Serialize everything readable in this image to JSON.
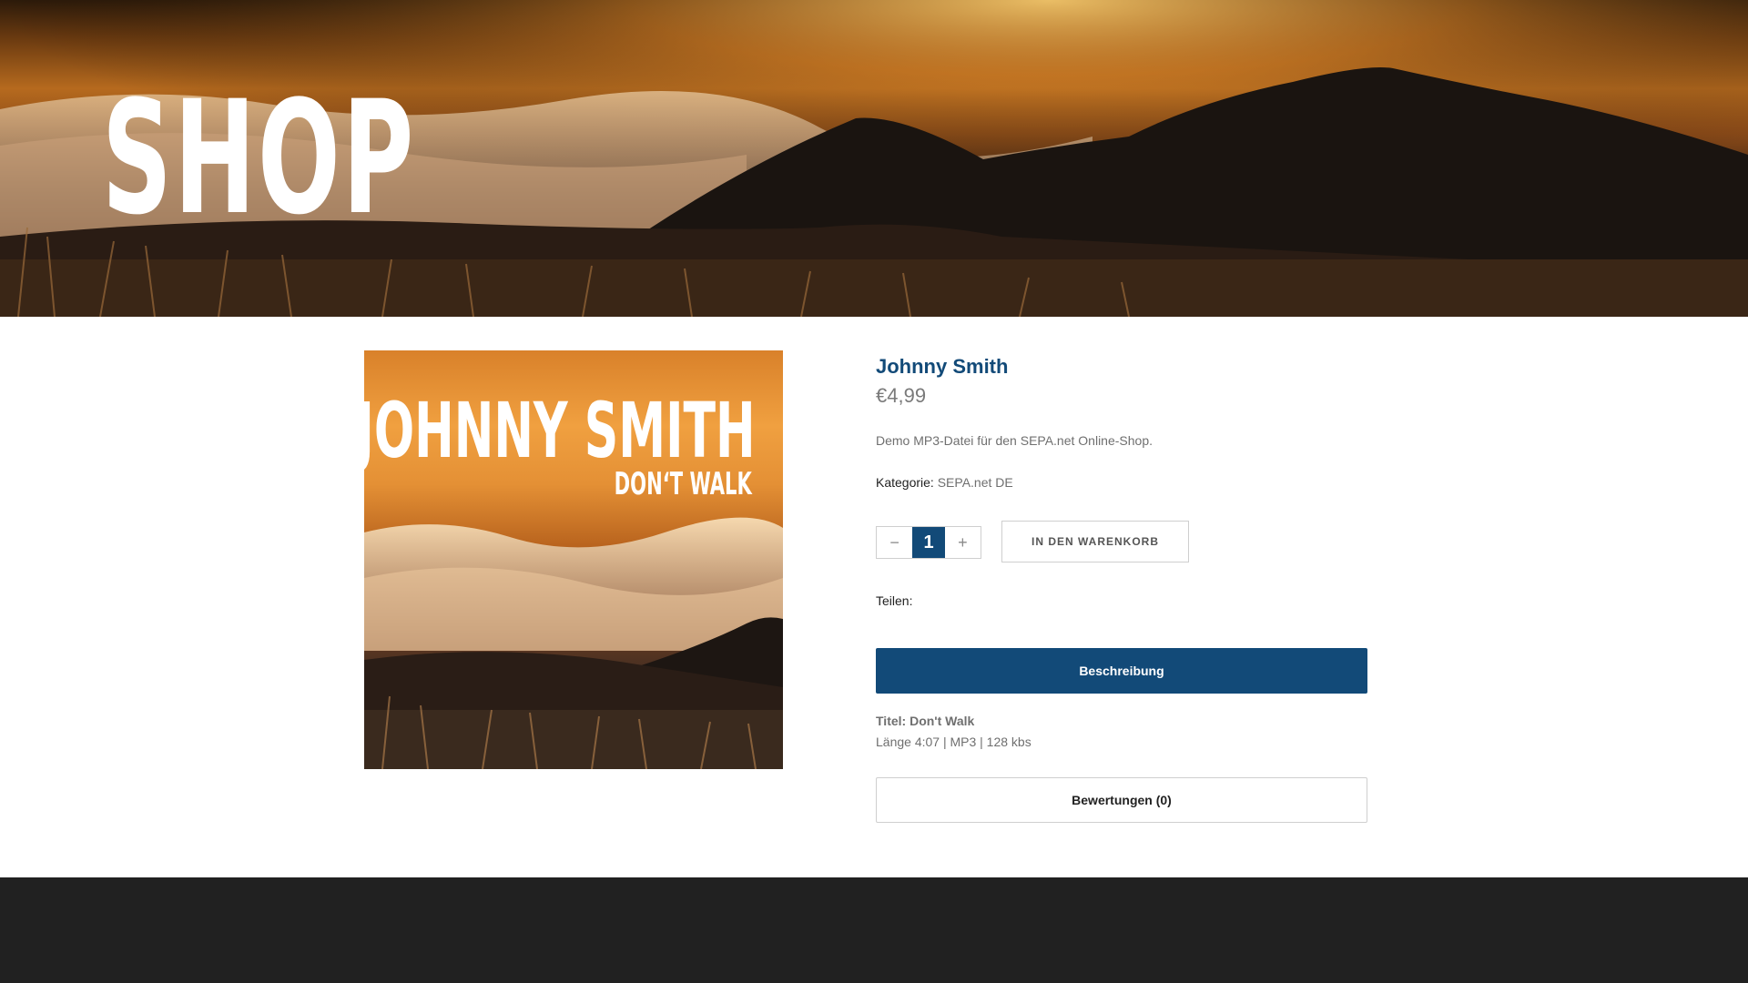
{
  "hero": {
    "title": "SHOP"
  },
  "product": {
    "cover": {
      "artist": "JOHNNY SMITH",
      "song": "DON‘T WALK"
    },
    "title": "Johnny Smith",
    "price": "€4,99",
    "description": "Demo MP3-Datei für den SEPA.net Online-Shop.",
    "category_label": "Kategorie:",
    "category_value": "SEPA.net DE",
    "quantity": {
      "minus": "−",
      "value": "1",
      "plus": "+"
    },
    "add_to_cart": "IN DEN WARENKORB",
    "share_label": "Teilen:"
  },
  "tabs": {
    "description_label": "Beschreibung",
    "description_title": "Titel: Don't Walk",
    "description_meta": "Länge 4:07 | MP3 | 128 kbs",
    "reviews_label": "Bewertungen (0)"
  },
  "colors": {
    "accent": "#124a78",
    "footer": "#212121"
  }
}
